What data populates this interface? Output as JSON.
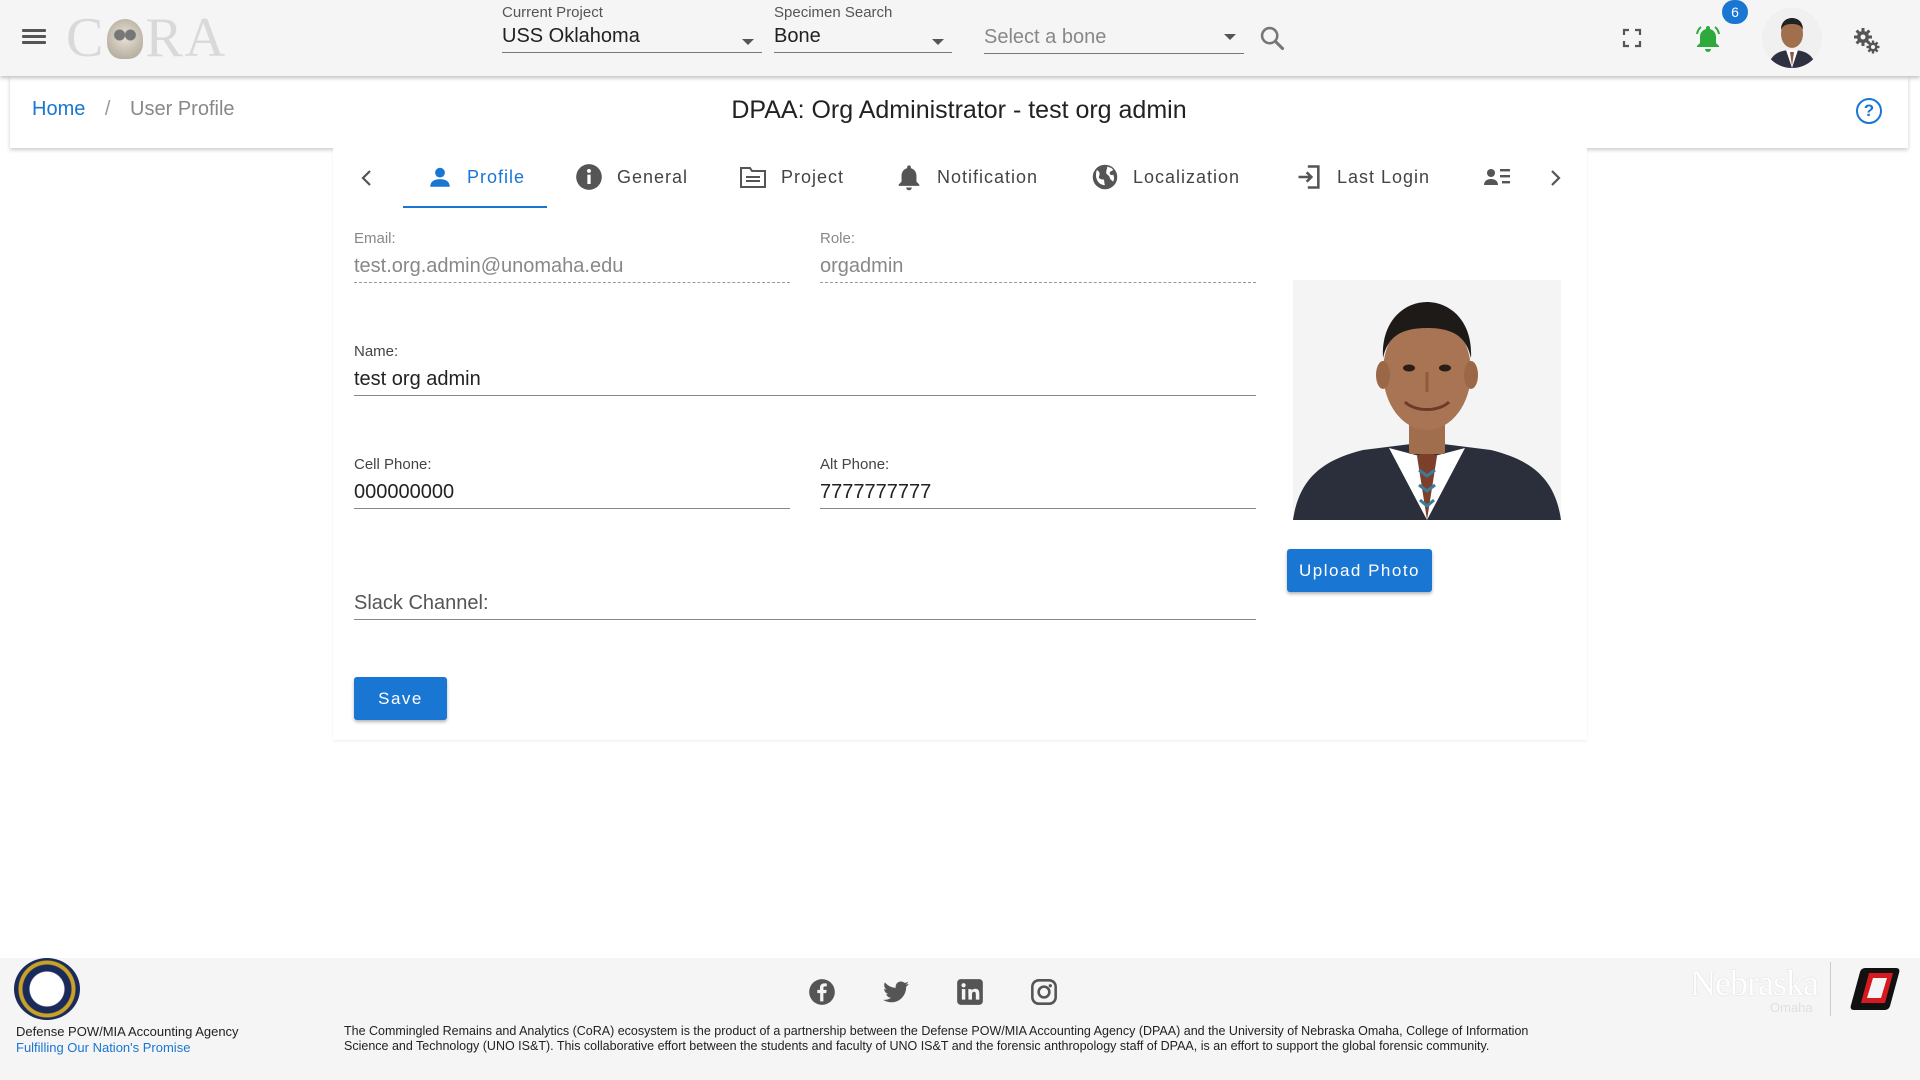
{
  "header": {
    "logo_text": "CORA",
    "current_project": {
      "label": "Current Project",
      "value": "USS Oklahoma"
    },
    "specimen_search": {
      "label": "Specimen Search",
      "value": "Bone"
    },
    "bone_select": {
      "placeholder": "Select a bone"
    },
    "notification_count": "6"
  },
  "breadcrumb": {
    "home": "Home",
    "separator": "/",
    "current": "User Profile"
  },
  "page_title": "DPAA: Org Administrator - test org admin",
  "help_icon": "?",
  "tabs": [
    {
      "label": "Profile",
      "icon": "person-icon",
      "active": true
    },
    {
      "label": "General",
      "icon": "info-icon"
    },
    {
      "label": "Project",
      "icon": "folder-icon"
    },
    {
      "label": "Notification",
      "icon": "bell-icon"
    },
    {
      "label": "Localization",
      "icon": "globe-icon"
    },
    {
      "label": "Last Login",
      "icon": "login-icon"
    },
    {
      "label": "",
      "icon": "user-list-icon"
    }
  ],
  "form": {
    "email": {
      "label": "Email:",
      "value": "test.org.admin@unomaha.edu"
    },
    "role": {
      "label": "Role:",
      "value": "orgadmin"
    },
    "name": {
      "label": "Name:",
      "value": "test org admin"
    },
    "cell_phone": {
      "label": "Cell Phone:",
      "value": "000000000"
    },
    "alt_phone": {
      "label": "Alt Phone:",
      "value": "7777777777"
    },
    "slack_channel": {
      "label": "Slack Channel:",
      "value": ""
    },
    "save_label": "Save",
    "upload_label": "Upload Photo"
  },
  "footer": {
    "agency_name": "Defense POW/MIA Accounting Agency",
    "agency_tagline": "Fulfilling Our Nation's Promise",
    "description": "The Commingled Remains and Analytics (CoRA) ecosystem is the product of a partnership between the Defense POW/MIA Accounting Agency (DPAA) and the University of Nebraska Omaha, College of Information Science and Technology (UNO IS&T). This collaborative effort between the students and faculty of UNO IS&T and the forensic anthropology staff of DPAA, is an effort to support the global forensic community.",
    "nebraska_text": "Nebraska",
    "omaha_text": "Omaha",
    "socials": [
      "facebook-icon",
      "twitter-icon",
      "linkedin-icon",
      "instagram-icon"
    ]
  },
  "colors": {
    "accent": "#1976d2",
    "bell": "#2eaa3c",
    "appbar_bg": "#f5f5f5",
    "uno_red": "#d71920"
  }
}
